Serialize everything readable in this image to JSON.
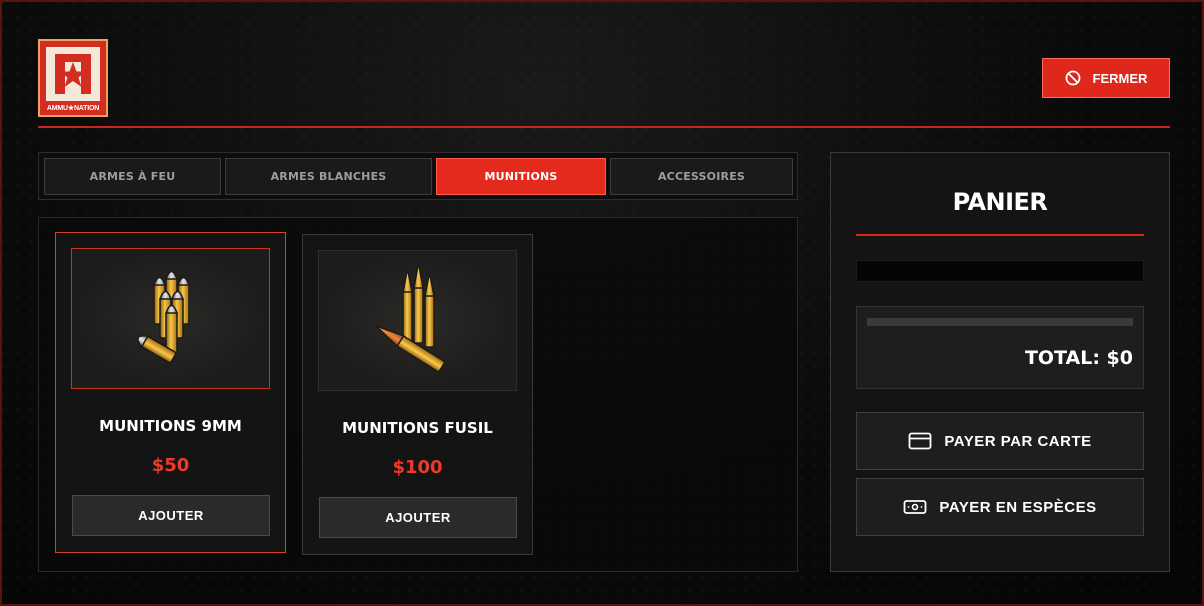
{
  "header": {
    "logo_text": "AMMU★NATION",
    "close_label": "FERMER"
  },
  "tabs": [
    {
      "label": "ARMES À FEU",
      "active": false
    },
    {
      "label": "ARMES BLANCHES",
      "active": false
    },
    {
      "label": "MUNITIONS",
      "active": true
    },
    {
      "label": "ACCESSOIRES",
      "active": false
    }
  ],
  "products": [
    {
      "name": "MUNITIONS 9MM",
      "price": "$50",
      "button": "AJOUTER",
      "icon": "pistol-ammo-icon",
      "selected": true
    },
    {
      "name": "MUNITIONS FUSIL",
      "price": "$100",
      "button": "AJOUTER",
      "icon": "rifle-ammo-icon",
      "selected": false
    }
  ],
  "cart": {
    "title": "PANIER",
    "total": "TOTAL: $0",
    "pay_card": "PAYER PAR CARTE",
    "pay_cash": "PAYER EN ESPÈCES"
  },
  "colors": {
    "accent": "#e32a1d",
    "price": "#ef3a2b",
    "background": "#070707"
  }
}
